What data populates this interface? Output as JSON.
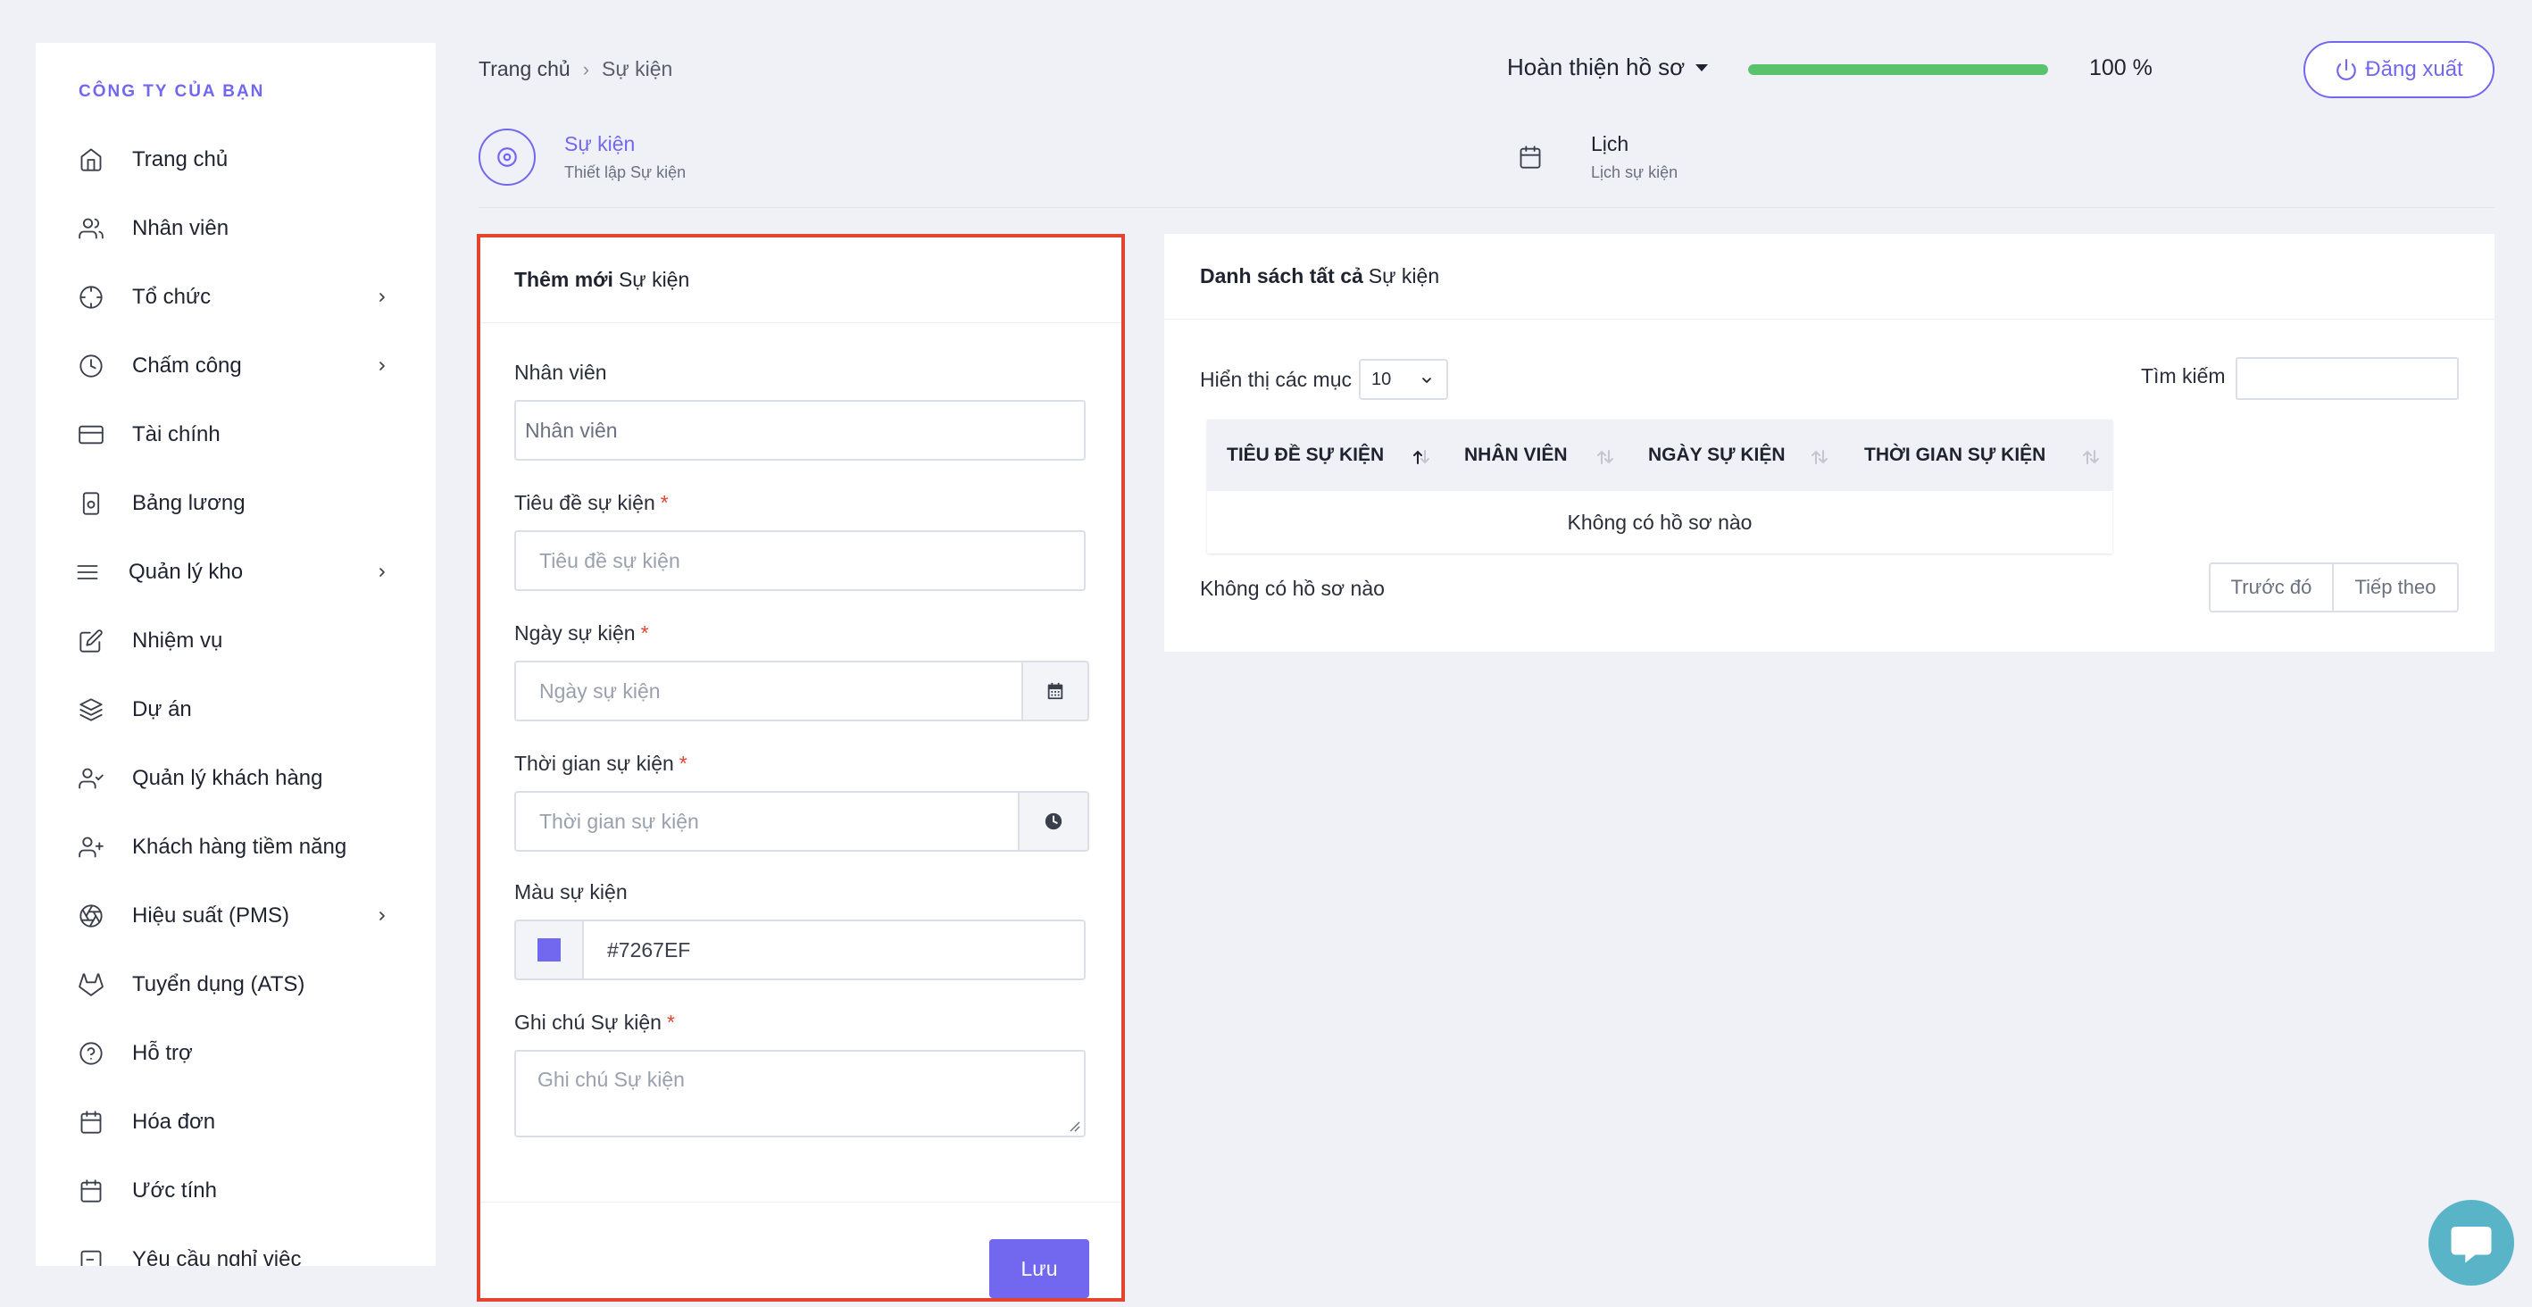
{
  "sidebar": {
    "company": "CÔNG TY CỦA BẠN",
    "items": [
      {
        "label": "Trang chủ",
        "icon": "home-icon",
        "has_children": false
      },
      {
        "label": "Nhân viên",
        "icon": "users-icon",
        "has_children": false
      },
      {
        "label": "Tổ chức",
        "icon": "crosshair-icon",
        "has_children": true
      },
      {
        "label": "Chấm công",
        "icon": "clock-icon",
        "has_children": true
      },
      {
        "label": "Tài chính",
        "icon": "credit-card-icon",
        "has_children": false
      },
      {
        "label": "Bảng lương",
        "icon": "payroll-icon",
        "has_children": false
      },
      {
        "label": "Quản lý kho",
        "icon": "menu-icon",
        "has_children": true
      },
      {
        "label": "Nhiệm vụ",
        "icon": "edit-icon",
        "has_children": false
      },
      {
        "label": "Dự án",
        "icon": "layers-icon",
        "has_children": false
      },
      {
        "label": "Quản lý khách hàng",
        "icon": "user-check-icon",
        "has_children": false
      },
      {
        "label": "Khách hàng tiềm năng",
        "icon": "user-plus-icon",
        "has_children": false
      },
      {
        "label": "Hiệu suất (PMS)",
        "icon": "aperture-icon",
        "has_children": true
      },
      {
        "label": "Tuyển dụng (ATS)",
        "icon": "gitlab-icon",
        "has_children": false
      },
      {
        "label": "Hỗ trợ",
        "icon": "help-circle-icon",
        "has_children": false
      },
      {
        "label": "Hóa đơn",
        "icon": "calendar-icon",
        "has_children": false
      },
      {
        "label": "Ước tính",
        "icon": "calendar-icon",
        "has_children": false
      },
      {
        "label": "Yêu cầu nghỉ việc",
        "icon": "logout-icon",
        "has_children": false
      }
    ]
  },
  "header": {
    "breadcrumb": {
      "home": "Trang chủ",
      "current": "Sự kiện"
    },
    "profile_label": "Hoàn thiện hồ sơ",
    "progress_percent": 100,
    "progress_text": "100 %",
    "logout_label": "Đăng xuất"
  },
  "tabs": {
    "events": {
      "title": "Sự kiện",
      "subtitle": "Thiết lập Sự kiện"
    },
    "calendar": {
      "title": "Lịch",
      "subtitle": "Lịch sự kiện"
    }
  },
  "form": {
    "title_bold": "Thêm mới",
    "title_rest": "Sự kiện",
    "employee": {
      "label": "Nhân viên",
      "placeholder": "Nhân viên"
    },
    "event_title": {
      "label": "Tiêu đề sự kiện",
      "placeholder": "Tiêu đề sự kiện"
    },
    "event_date": {
      "label": "Ngày sự kiện",
      "placeholder": "Ngày sự kiện"
    },
    "event_time": {
      "label": "Thời gian sự kiện",
      "placeholder": "Thời gian sự kiện"
    },
    "event_color": {
      "label": "Màu sự kiện",
      "value": "#7267EF"
    },
    "event_note": {
      "label": "Ghi chú Sự kiện",
      "placeholder": "Ghi chú Sự kiện"
    },
    "required_mark": "*",
    "save_label": "Lưu"
  },
  "list": {
    "title_bold": "Danh sách tất cả",
    "title_rest": "Sự kiện",
    "show_entries_label": "Hiển thị các mục",
    "page_size": "10",
    "search_label": "Tìm kiếm",
    "columns": [
      "TIÊU ĐỀ SỰ KIỆN",
      "NHÂN VIÊN",
      "NGÀY SỰ KIỆN",
      "THỜI GIAN SỰ KIỆN"
    ],
    "empty_message": "Không có hồ sơ nào",
    "info": "Không có hồ sơ nào",
    "prev_label": "Trước đó",
    "next_label": "Tiếp theo"
  },
  "colors": {
    "accent": "#7267ef",
    "progress": "#58c36c",
    "highlight_border": "#e2442f",
    "chat_bubble": "#5ab4c8"
  }
}
